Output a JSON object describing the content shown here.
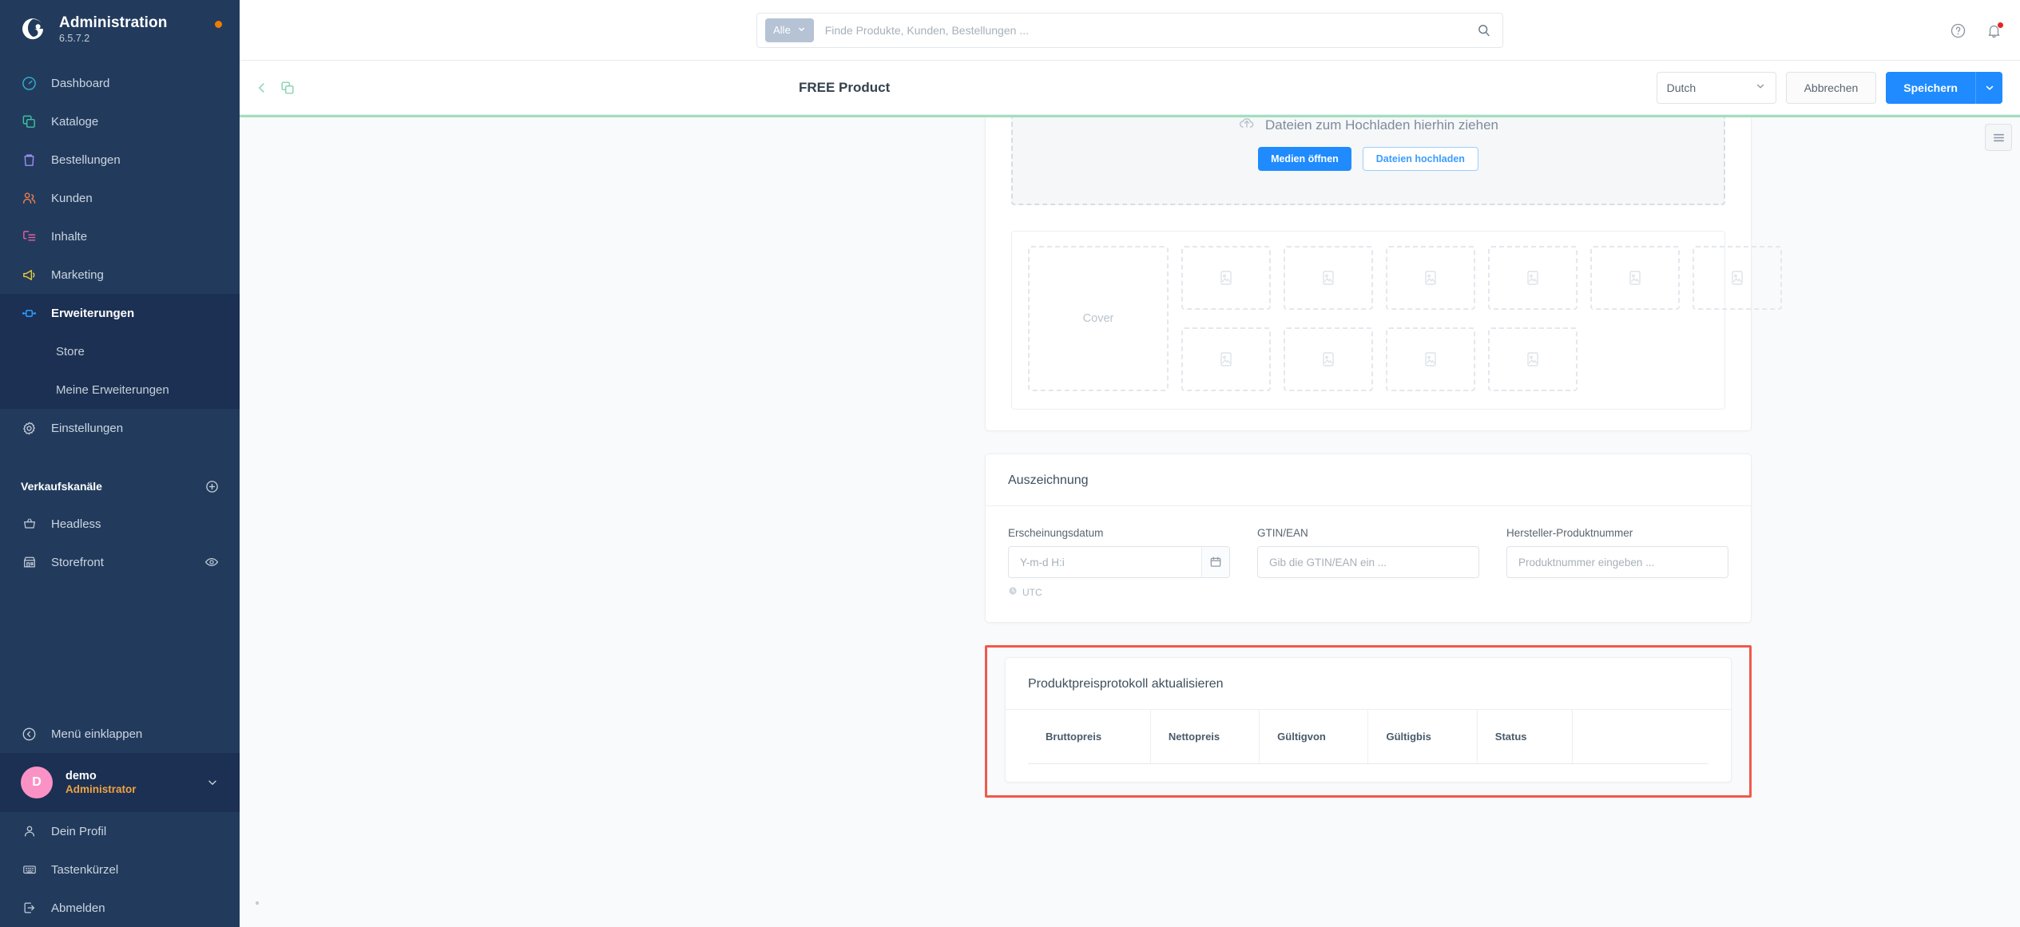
{
  "sidebar": {
    "brand": {
      "title": "Administration",
      "version": "6.5.7.2",
      "logo_icon": "shopware-logo-icon",
      "update_dot": "update-available-dot"
    },
    "nav": [
      {
        "label": "Dashboard",
        "icon": "dashboard-icon",
        "color": "#37afc9",
        "active": false
      },
      {
        "label": "Kataloge",
        "icon": "catalog-icon",
        "color": "#3ec2a0",
        "active": false
      },
      {
        "label": "Bestellungen",
        "icon": "orders-bag-icon",
        "color": "#9b8cf0",
        "active": false
      },
      {
        "label": "Kunden",
        "icon": "customers-icon",
        "color": "#ef7e4d",
        "active": false
      },
      {
        "label": "Inhalte",
        "icon": "content-icon",
        "color": "#e25fa0",
        "active": false
      },
      {
        "label": "Marketing",
        "icon": "megaphone-icon",
        "color": "#e8c93a",
        "active": false
      },
      {
        "label": "Erweiterungen",
        "icon": "plugin-icon",
        "color": "#2f9bff",
        "active": true
      }
    ],
    "sub_items": [
      {
        "label": "Store"
      },
      {
        "label": "Meine Erweiterungen"
      }
    ],
    "settings": {
      "label": "Einstellungen",
      "icon": "gear-icon"
    },
    "sales_channels": {
      "title": "Verkaufskanäle",
      "add_icon": "plus-circle-icon",
      "items": [
        {
          "label": "Headless",
          "icon": "basket-icon",
          "trailing_icon": null
        },
        {
          "label": "Storefront",
          "icon": "storefront-icon",
          "trailing_icon": "eye-icon"
        }
      ]
    },
    "collapse": {
      "label": "Menü einklappen",
      "icon": "chevron-left-circle-icon"
    },
    "user": {
      "initial": "D",
      "name": "demo",
      "role": "Administrator",
      "chevron_icon": "chevron-down-icon"
    },
    "user_menu": [
      {
        "label": "Dein Profil",
        "icon": "user-icon"
      },
      {
        "label": "Tastenkürzel",
        "icon": "keyboard-icon"
      },
      {
        "label": "Abmelden",
        "icon": "logout-icon"
      }
    ]
  },
  "topbar": {
    "search": {
      "scope_label": "Alle",
      "scope_caret_icon": "chevron-down-icon",
      "placeholder": "Finde Produkte, Kunden, Bestellungen ...",
      "value": "",
      "search_icon": "search-icon"
    },
    "help_icon": "help-circle-icon",
    "notifications_icon": "bell-icon",
    "notifications_badge": ""
  },
  "smartbar": {
    "back_icon": "chevron-left-icon",
    "duplicate_icon": "duplicate-icon",
    "title": "FREE Product",
    "language": {
      "value": "Dutch",
      "caret_icon": "chevron-down-icon"
    },
    "cancel_label": "Abbrechen",
    "save_label": "Speichern",
    "save_caret_icon": "chevron-down-icon"
  },
  "content": {
    "side_toggle_icon": "list-menu-icon",
    "media_card": {
      "dropzone": {
        "cloud_icon": "cloud-upload-icon",
        "text": "Dateien zum Hochladen hierhin ziehen",
        "open_media_label": "Medien öffnen",
        "upload_files_label": "Dateien hochladen"
      },
      "cover_label": "Cover",
      "slot_icon": "image-placeholder-icon",
      "slots_row1": 6,
      "slots_row2": 4
    },
    "awards_card": {
      "title": "Auszeichnung",
      "fields": [
        {
          "label": "Erscheinungsdatum",
          "placeholder": "Y-m-d H:i",
          "value": "",
          "type": "date",
          "calendar_icon": "calendar-icon",
          "note": "UTC",
          "note_icon": "clock-icon"
        },
        {
          "label": "GTIN/EAN",
          "placeholder": "Gib die GTIN/EAN ein ...",
          "value": "",
          "type": "text"
        },
        {
          "label": "Hersteller-Produktnummer",
          "placeholder": "Produktnummer eingeben ...",
          "value": "",
          "type": "text"
        }
      ]
    },
    "price_log_card": {
      "title": "Produktpreisprotokoll aktualisieren",
      "columns": [
        "Bruttopreis",
        "Nettopreis",
        "Gültigvon",
        "Gültigbis",
        "Status",
        ""
      ],
      "rows": [],
      "highlight_color": "#f0594c"
    }
  }
}
